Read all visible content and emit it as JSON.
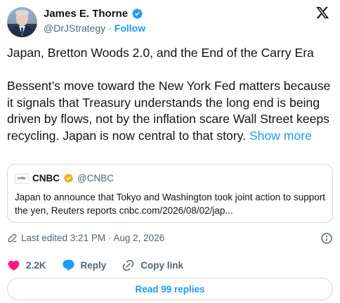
{
  "author": {
    "name": "James E. Thorne",
    "handle": "@DrJStrategy",
    "separator": "·",
    "follow_label": "Follow"
  },
  "tweet": {
    "title_line": "Japan, Bretton Woods 2.0, and the End of the Carry Era",
    "body": "Bessent’s move toward the New York Fed matters because it signals that Treasury understands the long end is being driven by flows, not by the inflation scare Wall Street keeps recycling. Japan is now central to that story.",
    "show_more": "Show more"
  },
  "quote": {
    "logo_text": "cnbc",
    "name": "CNBC",
    "handle": "@CNBC",
    "text": "Japan to announce that Tokyo and Washington took joint action to support the yen, Reuters reports cnbc.com/2026/08/02/jap..."
  },
  "meta": {
    "edited": "Last edited 3:21 PM · Aug 2, 2026"
  },
  "actions": {
    "likes": "2.2K",
    "reply_label": "Reply",
    "copy_link_label": "Copy link"
  },
  "footer": {
    "read_replies": "Read 99 replies"
  },
  "icons": {
    "verified": "verified-badge-icon",
    "x_logo": "x-logo-icon",
    "pencil": "pencil-icon",
    "info": "info-icon",
    "heart": "heart-icon",
    "reply": "reply-bubble-icon",
    "link": "link-icon"
  },
  "colors": {
    "accent": "#1d9bf0",
    "heart": "#f91880",
    "muted": "#536471",
    "text": "#0f1419",
    "border": "#cfd9de",
    "gold": "#e2b719"
  }
}
